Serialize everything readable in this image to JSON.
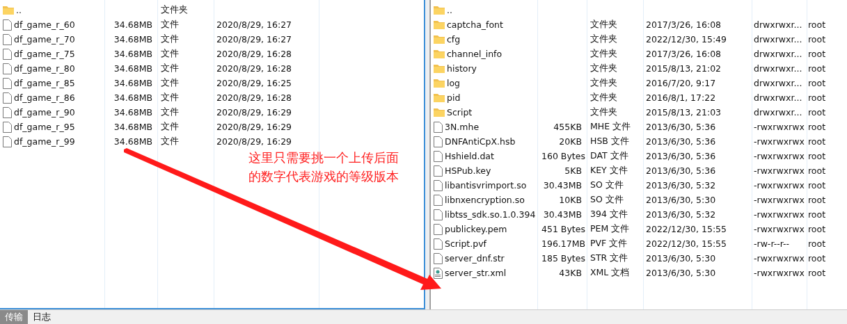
{
  "local_pane": {
    "rows": [
      {
        "kind": "folder",
        "name": "..",
        "type": "文件夹"
      },
      {
        "kind": "file",
        "name": "df_game_r_60",
        "size": "34.68MB",
        "type": "文件",
        "modified": "2020/8/29, 16:27"
      },
      {
        "kind": "file",
        "name": "df_game_r_70",
        "size": "34.68MB",
        "type": "文件",
        "modified": "2020/8/29, 16:27"
      },
      {
        "kind": "file",
        "name": "df_game_r_75",
        "size": "34.68MB",
        "type": "文件",
        "modified": "2020/8/29, 16:28"
      },
      {
        "kind": "file",
        "name": "df_game_r_80",
        "size": "34.68MB",
        "type": "文件",
        "modified": "2020/8/29, 16:28"
      },
      {
        "kind": "file",
        "name": "df_game_r_85",
        "size": "34.68MB",
        "type": "文件",
        "modified": "2020/8/29, 16:25"
      },
      {
        "kind": "file",
        "name": "df_game_r_86",
        "size": "34.68MB",
        "type": "文件",
        "modified": "2020/8/29, 16:28"
      },
      {
        "kind": "file",
        "name": "df_game_r_90",
        "size": "34.68MB",
        "type": "文件",
        "modified": "2020/8/29, 16:29"
      },
      {
        "kind": "file",
        "name": "df_game_r_95",
        "size": "34.68MB",
        "type": "文件",
        "modified": "2020/8/29, 16:29"
      },
      {
        "kind": "file",
        "name": "df_game_r_99",
        "size": "34.68MB",
        "type": "文件",
        "modified": "2020/8/29, 16:29"
      }
    ]
  },
  "remote_pane": {
    "rows": [
      {
        "kind": "folder",
        "name": ".."
      },
      {
        "kind": "folder",
        "name": "captcha_font",
        "type": "文件夹",
        "modified": "2017/3/26, 16:08",
        "permissions": "drwxrwxr...",
        "owner": "root"
      },
      {
        "kind": "folder",
        "name": "cfg",
        "type": "文件夹",
        "modified": "2022/12/30, 15:49",
        "permissions": "drwxrwxr...",
        "owner": "root"
      },
      {
        "kind": "folder",
        "name": "channel_info",
        "type": "文件夹",
        "modified": "2017/3/26, 16:08",
        "permissions": "drwxrwxr...",
        "owner": "root"
      },
      {
        "kind": "folder",
        "name": "history",
        "type": "文件夹",
        "modified": "2015/8/13, 21:02",
        "permissions": "drwxrwxr...",
        "owner": "root"
      },
      {
        "kind": "folder",
        "name": "log",
        "type": "文件夹",
        "modified": "2016/7/20, 9:17",
        "permissions": "drwxrwxr...",
        "owner": "root"
      },
      {
        "kind": "folder",
        "name": "pid",
        "type": "文件夹",
        "modified": "2016/8/1, 17:22",
        "permissions": "drwxrwxr...",
        "owner": "root"
      },
      {
        "kind": "folder",
        "name": "Script",
        "type": "文件夹",
        "modified": "2015/8/13, 21:03",
        "permissions": "drwxrwxr...",
        "owner": "root"
      },
      {
        "kind": "file",
        "name": "3N.mhe",
        "size": "455KB",
        "type": "MHE 文件",
        "modified": "2013/6/30, 5:36",
        "permissions": "-rwxrwxrwx",
        "owner": "root"
      },
      {
        "kind": "file",
        "name": "DNFAntiCpX.hsb",
        "size": "20KB",
        "type": "HSB 文件",
        "modified": "2013/6/30, 5:36",
        "permissions": "-rwxrwxrwx",
        "owner": "root"
      },
      {
        "kind": "file",
        "name": "Hshield.dat",
        "size": "160 Bytes",
        "type": "DAT 文件",
        "modified": "2013/6/30, 5:36",
        "permissions": "-rwxrwxrwx",
        "owner": "root"
      },
      {
        "kind": "file",
        "name": "HSPub.key",
        "size": "5KB",
        "type": "KEY 文件",
        "modified": "2013/6/30, 5:36",
        "permissions": "-rwxrwxrwx",
        "owner": "root"
      },
      {
        "kind": "file",
        "name": "libantisvrimport.so",
        "size": "30.43MB",
        "type": "SO 文件",
        "modified": "2013/6/30, 5:32",
        "permissions": "-rwxrwxrwx",
        "owner": "root"
      },
      {
        "kind": "file",
        "name": "libnxencryption.so",
        "size": "10KB",
        "type": "SO 文件",
        "modified": "2013/6/30, 5:30",
        "permissions": "-rwxrwxrwx",
        "owner": "root"
      },
      {
        "kind": "file",
        "name": "libtss_sdk.so.1.0.394",
        "size": "30.43MB",
        "type": "394 文件",
        "modified": "2013/6/30, 5:32",
        "permissions": "-rwxrwxrwx",
        "owner": "root"
      },
      {
        "kind": "file",
        "name": "publickey.pem",
        "size": "451 Bytes",
        "type": "PEM 文件",
        "modified": "2022/12/30, 15:55",
        "permissions": "-rwxrwxrwx",
        "owner": "root"
      },
      {
        "kind": "file",
        "name": "Script.pvf",
        "size": "196.17MB",
        "type": "PVF 文件",
        "modified": "2022/12/30, 15:55",
        "permissions": "-rw-r--r--",
        "owner": "root"
      },
      {
        "kind": "file",
        "name": "server_dnf.str",
        "size": "185 Bytes",
        "type": "STR 文件",
        "modified": "2013/6/30, 5:30",
        "permissions": "-rwxrwxrwx",
        "owner": "root"
      },
      {
        "kind": "xml",
        "name": "server_str.xml",
        "size": "43KB",
        "type": "XML 文档",
        "modified": "2013/6/30, 5:30",
        "permissions": "-rwxrwxrwx",
        "owner": "root"
      }
    ]
  },
  "annotation": {
    "lines": [
      "这里只需要挑一个上传后面",
      "的数字代表游戏的等级版本"
    ]
  },
  "bottom_tabs": [
    {
      "label": "传输",
      "selected": true
    },
    {
      "label": "日志",
      "selected": false
    }
  ]
}
